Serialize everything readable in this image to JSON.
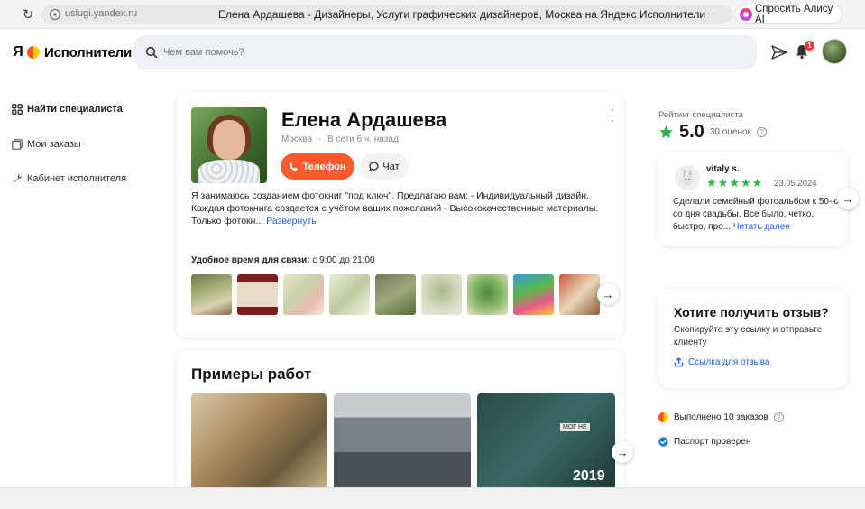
{
  "browser": {
    "url": "uslugi.yandex.ru",
    "tab_title": "Елена Ардашева - Дизайнеры, Услуги графических дизайнеров, Москва на Яндекс Исполнители",
    "alice_label": "Спросить Алису AI"
  },
  "header": {
    "logo_ya": "Я",
    "logo_text": "Исполнители",
    "search_placeholder": "Чем вам помочь?",
    "notifications_count": "1"
  },
  "sidebar": {
    "items": [
      {
        "label": "Найти специалиста",
        "icon": "grid-icon"
      },
      {
        "label": "Мои заказы",
        "icon": "orders-icon"
      },
      {
        "label": "Кабинет исполнителя",
        "icon": "wrench-icon"
      }
    ]
  },
  "profile": {
    "name": "Елена Ардашева",
    "city": "Москва",
    "separator": "·",
    "online": "В сети 6 ч. назад",
    "phone_label": "Телефон",
    "chat_label": "Чат",
    "description": "Я занимаюсь созданием фотокниг \"под ключ\". Предлагаю вам: - Индивидуальный дизайн. Каждая фотокнига создается с учётом ваших пожеланий - Высококачественные материалы. Только фотокн...",
    "more_label": "Развернуть",
    "hours_label": "Удобное время для связи:",
    "hours_value": "с 9:00 до 21:00",
    "thumb_count": 9
  },
  "examples": {
    "title": "Примеры работ",
    "second_image_year": "2019",
    "third_image_tag": "МОГ НЕ"
  },
  "rating": {
    "label": "Рейтинг специалиста",
    "value": "5.0",
    "count": "30 оценок"
  },
  "review": {
    "author": "vitaly s.",
    "stars": 5,
    "date": "23.05.2024",
    "text": "Сделали семейный фотоальбом к 50-ю со дня свадьбы. Все было, четко, быстро, про...",
    "more_label": "Читать далее"
  },
  "get_review": {
    "title": "Хотите получить отзыв?",
    "subtitle": "Скопируйте эту ссылку и отправьте клиенту",
    "link_label": "Ссылка для отзыва"
  },
  "stats": {
    "orders": "Выполнено 10 заказов",
    "passport": "Паспорт проверен"
  },
  "colors": {
    "accent": "#ff5a2b",
    "link": "#1f5fd8",
    "star": "#2fb44a"
  }
}
